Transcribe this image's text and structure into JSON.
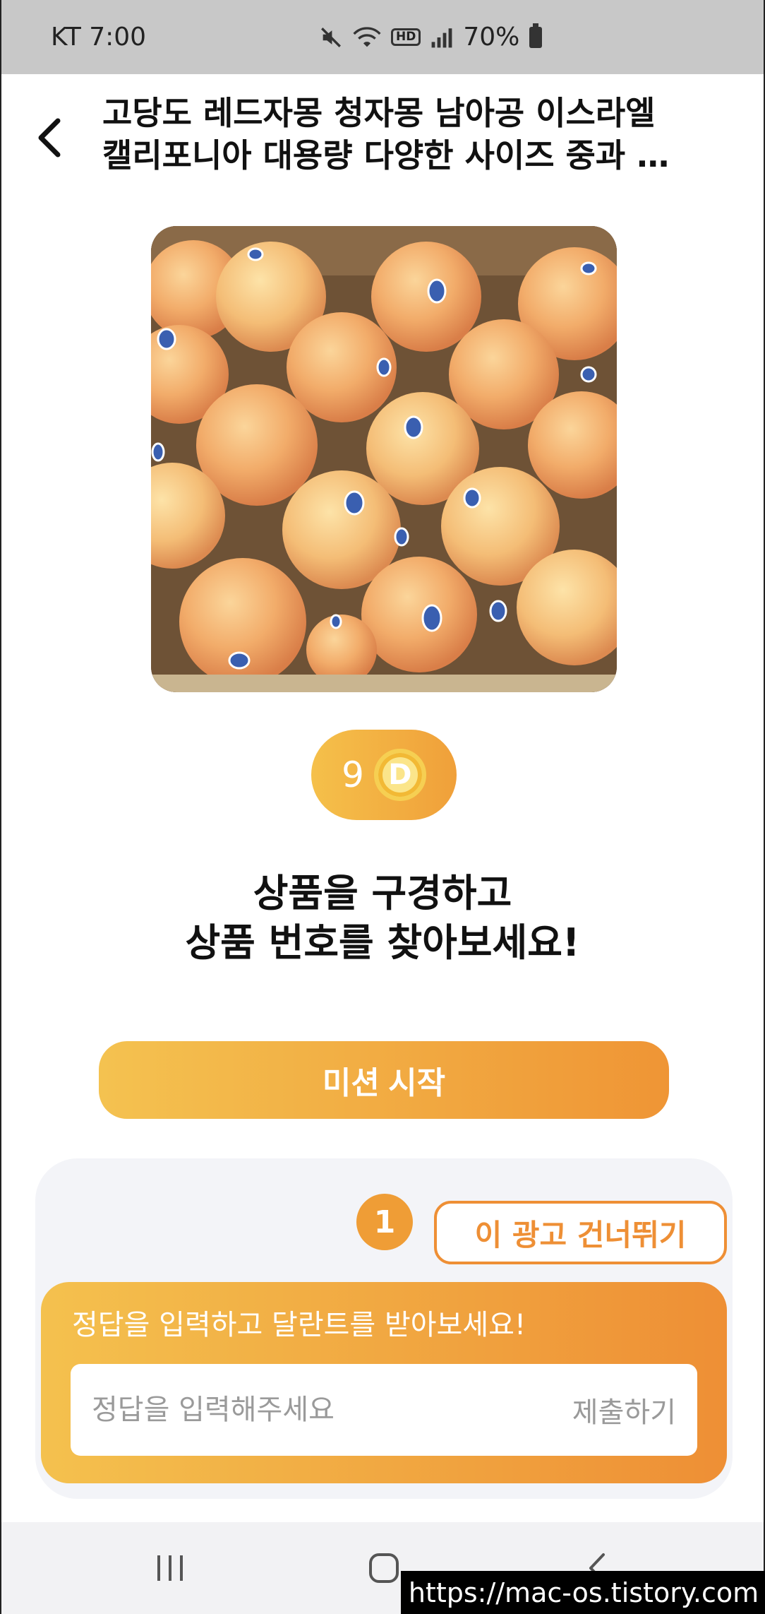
{
  "status_bar": {
    "carrier_time": "KT 7:00",
    "hd": "HD",
    "battery": "70%"
  },
  "header": {
    "title_line1": "고당도 레드자몽 청자몽 남아공 이스라엘",
    "title_line2": "캘리포니아 대용량 다양한 사이즈 중과 …"
  },
  "reward": {
    "amount": "9",
    "coin_symbol": "D"
  },
  "instruction": {
    "line1": "상품을 구경하고",
    "line2": "상품 번호를 찾아보세요!"
  },
  "mission_button": "미션 시작",
  "bottom_card": {
    "step": "1",
    "skip_label": "이 광고 건너뛰기",
    "prompt": "정답을 입력하고 달란트를 받아보세요!",
    "input_placeholder": "정답을 입력해주세요",
    "submit_label": "제출하기"
  },
  "watermark": "https://mac-os.tistory.com",
  "colors": {
    "accent_start": "#f4c250",
    "accent_end": "#ef9535",
    "card_bg": "#f3f4f8"
  }
}
